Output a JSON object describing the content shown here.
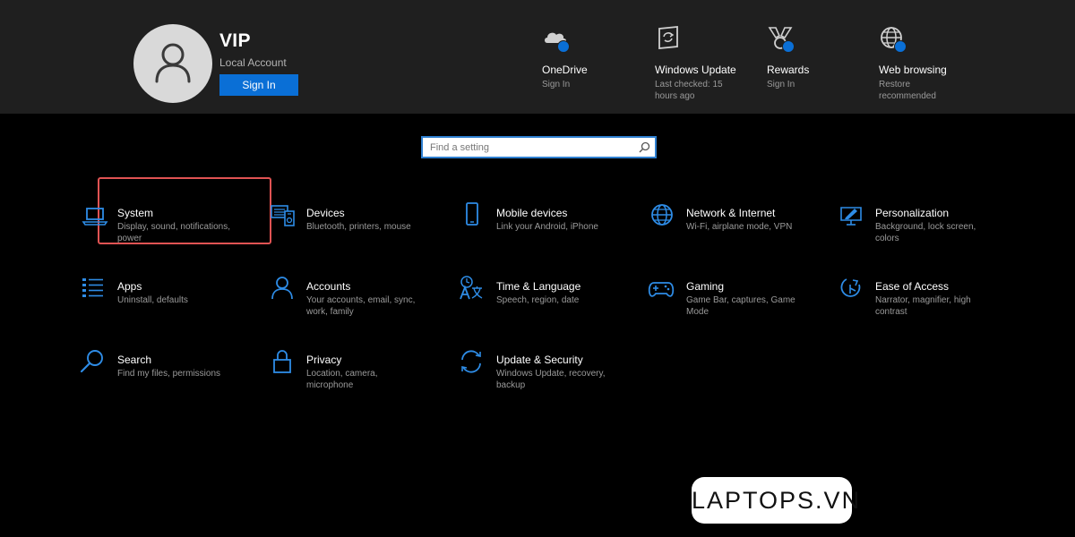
{
  "colors": {
    "accent": "#0a6fd6",
    "icon_blue": "#2e8ce6",
    "selection": "#e05353"
  },
  "user": {
    "name": "VIP",
    "account_type": "Local Account",
    "sign_in_label": "Sign In"
  },
  "header_items": [
    {
      "icon": "onedrive-icon",
      "title": "OneDrive",
      "subtitle": "Sign In"
    },
    {
      "icon": "windows-update-icon",
      "title": "Windows Update",
      "subtitle": "Last checked: 15 hours ago"
    },
    {
      "icon": "rewards-icon",
      "title": "Rewards",
      "subtitle": "Sign In"
    },
    {
      "icon": "web-browsing-icon",
      "title": "Web browsing",
      "subtitle": "Restore recommended"
    }
  ],
  "search": {
    "placeholder": "Find a setting",
    "value": ""
  },
  "tiles": [
    {
      "icon": "laptop-icon",
      "title": "System",
      "desc": "Display, sound, notifications, power",
      "selected": true
    },
    {
      "icon": "devices-icon",
      "title": "Devices",
      "desc": "Bluetooth, printers, mouse"
    },
    {
      "icon": "phone-icon",
      "title": "Mobile devices",
      "desc": "Link your Android, iPhone"
    },
    {
      "icon": "globe-icon",
      "title": "Network & Internet",
      "desc": "Wi-Fi, airplane mode, VPN"
    },
    {
      "icon": "personalization-icon",
      "title": "Personalization",
      "desc": "Background, lock screen, colors"
    },
    {
      "icon": "apps-icon",
      "title": "Apps",
      "desc": "Uninstall, defaults"
    },
    {
      "icon": "person-icon",
      "title": "Accounts",
      "desc": "Your accounts, email, sync, work, family"
    },
    {
      "icon": "time-language-icon",
      "title": "Time & Language",
      "desc": "Speech, region, date"
    },
    {
      "icon": "gamepad-icon",
      "title": "Gaming",
      "desc": "Game Bar, captures, Game Mode"
    },
    {
      "icon": "ease-of-access-icon",
      "title": "Ease of Access",
      "desc": "Narrator, magnifier, high contrast"
    },
    {
      "icon": "search-icon",
      "title": "Search",
      "desc": "Find my files, permissions"
    },
    {
      "icon": "lock-icon",
      "title": "Privacy",
      "desc": "Location, camera, microphone"
    },
    {
      "icon": "sync-icon",
      "title": "Update & Security",
      "desc": "Windows Update, recovery, backup"
    }
  ],
  "watermark": {
    "text": "LAPTOPS.VN"
  }
}
